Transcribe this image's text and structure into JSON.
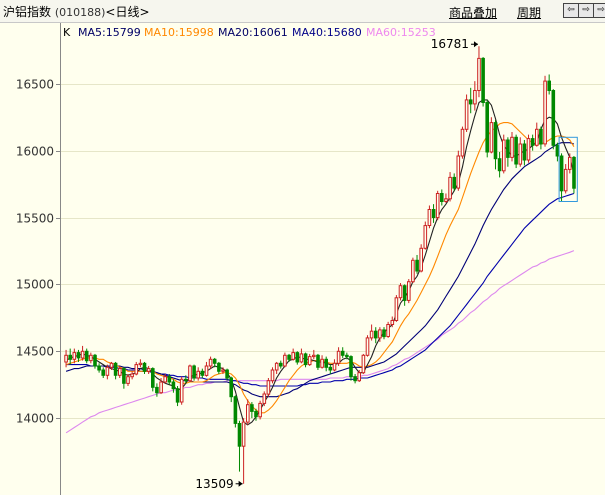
{
  "header": {
    "name": "沪铝指数",
    "code": "(010188)",
    "period": "<日线>",
    "tab_overlay": "商品叠加",
    "tab_cycle": "周期",
    "btn_prev": "⇦",
    "btn_mid": "⇨",
    "btn_next": "⇨"
  },
  "chart_data": {
    "type": "candlestick",
    "ylim": [
      13440,
      16880
    ],
    "yticks": [
      14000,
      14500,
      15000,
      15500,
      16000,
      16500
    ],
    "grid": true,
    "legend": {
      "prefix": "K",
      "items": [
        {
          "label": "MA5:15799",
          "color": "#000066"
        },
        {
          "label": "MA10:15998",
          "color": "#FF8800"
        },
        {
          "label": "MA20:16061",
          "color": "#000066"
        },
        {
          "label": "MA40:15680",
          "color": "#000088"
        },
        {
          "label": "MA60:15253",
          "color": "#EE88EE"
        }
      ]
    },
    "annotations": {
      "high": "16781",
      "low": "13509"
    },
    "colors": {
      "up": "#CC2222",
      "down": "#008800",
      "ma5": "#222222",
      "ma10": "#FF8800",
      "ma20": "#000077",
      "ma40": "#0000AA",
      "ma60": "#DD88EE"
    },
    "candles": [
      [
        14420,
        14470,
        14510,
        14380
      ],
      [
        14470,
        14440,
        14520,
        14400
      ],
      [
        14440,
        14490,
        14520,
        14410
      ],
      [
        14490,
        14450,
        14510,
        14420
      ],
      [
        14450,
        14500,
        14540,
        14430
      ],
      [
        14500,
        14430,
        14520,
        14410
      ],
      [
        14430,
        14470,
        14490,
        14410
      ],
      [
        14470,
        14390,
        14480,
        14370
      ],
      [
        14390,
        14360,
        14410,
        14340
      ],
      [
        14360,
        14320,
        14380,
        14300
      ],
      [
        14320,
        14380,
        14400,
        14290
      ],
      [
        14380,
        14410,
        14420,
        14360
      ],
      [
        14410,
        14320,
        14420,
        14290
      ],
      [
        14320,
        14370,
        14390,
        14300
      ],
      [
        14370,
        14260,
        14380,
        14220
      ],
      [
        14260,
        14310,
        14330,
        14240
      ],
      [
        14310,
        14330,
        14350,
        14290
      ],
      [
        14330,
        14400,
        14420,
        14320
      ],
      [
        14400,
        14410,
        14440,
        14380
      ],
      [
        14410,
        14350,
        14420,
        14330
      ],
      [
        14350,
        14370,
        14390,
        14330
      ],
      [
        14370,
        14230,
        14380,
        14200
      ],
      [
        14230,
        14190,
        14260,
        14160
      ],
      [
        14190,
        14270,
        14300,
        14180
      ],
      [
        14270,
        14310,
        14330,
        14260
      ],
      [
        14310,
        14270,
        14330,
        14250
      ],
      [
        14270,
        14220,
        14290,
        14190
      ],
      [
        14220,
        14120,
        14240,
        14090
      ],
      [
        14120,
        14290,
        14310,
        14100
      ],
      [
        14290,
        14280,
        14320,
        14260
      ],
      [
        14280,
        14390,
        14400,
        14270
      ],
      [
        14390,
        14300,
        14400,
        14280
      ],
      [
        14300,
        14350,
        14380,
        14280
      ],
      [
        14350,
        14320,
        14370,
        14300
      ],
      [
        14320,
        14390,
        14420,
        14310
      ],
      [
        14390,
        14440,
        14460,
        14370
      ],
      [
        14440,
        14410,
        14450,
        14380
      ],
      [
        14410,
        14350,
        14420,
        14330
      ],
      [
        14350,
        14360,
        14380,
        14330
      ],
      [
        14360,
        14300,
        14370,
        14280
      ],
      [
        14300,
        14160,
        14310,
        14120
      ],
      [
        14160,
        13960,
        14170,
        13930
      ],
      [
        13960,
        13790,
        13980,
        13600
      ],
      [
        13790,
        13970,
        14000,
        13509
      ],
      [
        13970,
        14100,
        14140,
        13950
      ],
      [
        14100,
        14050,
        14120,
        14000
      ],
      [
        14050,
        14010,
        14070,
        13980
      ],
      [
        14010,
        14110,
        14130,
        13990
      ],
      [
        14110,
        14180,
        14200,
        14090
      ],
      [
        14180,
        14280,
        14300,
        14160
      ],
      [
        14280,
        14360,
        14380,
        14260
      ],
      [
        14360,
        14410,
        14420,
        14330
      ],
      [
        14410,
        14390,
        14430,
        14370
      ],
      [
        14390,
        14470,
        14490,
        14380
      ],
      [
        14470,
        14440,
        14480,
        14420
      ],
      [
        14440,
        14490,
        14520,
        14430
      ],
      [
        14490,
        14420,
        14500,
        14400
      ],
      [
        14420,
        14480,
        14520,
        14410
      ],
      [
        14480,
        14400,
        14490,
        14380
      ],
      [
        14400,
        14460,
        14480,
        14390
      ],
      [
        14460,
        14470,
        14510,
        14440
      ],
      [
        14470,
        14380,
        14480,
        14360
      ],
      [
        14380,
        14440,
        14470,
        14370
      ],
      [
        14440,
        14380,
        14460,
        14350
      ],
      [
        14380,
        14360,
        14400,
        14330
      ],
      [
        14360,
        14410,
        14440,
        14350
      ],
      [
        14410,
        14500,
        14530,
        14390
      ],
      [
        14500,
        14470,
        14530,
        14450
      ],
      [
        14470,
        14460,
        14490,
        14440
      ],
      [
        14460,
        14310,
        14470,
        14280
      ],
      [
        14310,
        14280,
        14330,
        14260
      ],
      [
        14280,
        14340,
        14360,
        14270
      ],
      [
        14340,
        14470,
        14480,
        14330
      ],
      [
        14470,
        14600,
        14620,
        14460
      ],
      [
        14600,
        14650,
        14700,
        14580
      ],
      [
        14650,
        14600,
        14680,
        14560
      ],
      [
        14600,
        14660,
        14680,
        14570
      ],
      [
        14660,
        14610,
        14680,
        14590
      ],
      [
        14610,
        14700,
        14720,
        14600
      ],
      [
        14700,
        14730,
        14760,
        14680
      ],
      [
        14730,
        14900,
        14920,
        14720
      ],
      [
        14900,
        14990,
        15010,
        14880
      ],
      [
        14990,
        14880,
        15000,
        14840
      ],
      [
        14880,
        15020,
        15040,
        14860
      ],
      [
        15020,
        15180,
        15200,
        15010
      ],
      [
        15180,
        15100,
        15220,
        15080
      ],
      [
        15100,
        15270,
        15300,
        15090
      ],
      [
        15270,
        15440,
        15470,
        15260
      ],
      [
        15440,
        15560,
        15590,
        15420
      ],
      [
        15560,
        15500,
        15600,
        15460
      ],
      [
        15500,
        15680,
        15700,
        15480
      ],
      [
        15680,
        15620,
        15710,
        15590
      ],
      [
        15620,
        15640,
        15680,
        15610
      ],
      [
        15640,
        15800,
        15840,
        15620
      ],
      [
        15800,
        15720,
        15830,
        15700
      ],
      [
        15720,
        15960,
        16000,
        15700
      ],
      [
        15960,
        16160,
        16180,
        15940
      ],
      [
        16160,
        16380,
        16420,
        16140
      ],
      [
        16380,
        16350,
        16470,
        16280
      ],
      [
        16350,
        16450,
        16520,
        16300
      ],
      [
        16450,
        16690,
        16781,
        16400
      ],
      [
        16690,
        16360,
        16700,
        16330
      ],
      [
        16360,
        15990,
        16380,
        15950
      ],
      [
        15990,
        16210,
        16250,
        15980
      ],
      [
        16210,
        15940,
        16230,
        15860
      ],
      [
        15940,
        15850,
        15990,
        15800
      ],
      [
        15850,
        16080,
        16120,
        15830
      ],
      [
        16080,
        15950,
        16100,
        15880
      ],
      [
        15950,
        16100,
        16140,
        15920
      ],
      [
        16100,
        15900,
        16120,
        15870
      ],
      [
        15900,
        16050,
        16100,
        15880
      ],
      [
        16050,
        15930,
        16080,
        15890
      ],
      [
        15930,
        16090,
        16120,
        15910
      ],
      [
        16090,
        16040,
        16120,
        16000
      ],
      [
        16040,
        16160,
        16210,
        16030
      ],
      [
        16160,
        16050,
        16180,
        16010
      ],
      [
        16050,
        16520,
        16560,
        16030
      ],
      [
        16520,
        16450,
        16570,
        16420
      ],
      [
        16450,
        16040,
        16460,
        16010
      ],
      [
        16040,
        15960,
        16060,
        15920
      ],
      [
        15960,
        15700,
        15980,
        15620
      ],
      [
        15700,
        15860,
        15900,
        15680
      ],
      [
        15860,
        15950,
        15980,
        15830
      ],
      [
        15950,
        15720,
        15960,
        15680
      ]
    ],
    "ma5": [
      14430,
      14450,
      14460,
      14470,
      14480,
      14470,
      14460,
      14440,
      14420,
      14400,
      14380,
      14370,
      14360,
      14350,
      14330,
      14320,
      14330,
      14340,
      14370,
      14380,
      14370,
      14330,
      14300,
      14280,
      14260,
      14250,
      14240,
      14210,
      14220,
      14260,
      14310,
      14320,
      14330,
      14340,
      14350,
      14370,
      14390,
      14380,
      14370,
      14340,
      14290,
      14200,
      14080,
      13970,
      13950,
      13970,
      14010,
      14060,
      14120,
      14170,
      14230,
      14300,
      14350,
      14390,
      14430,
      14440,
      14460,
      14450,
      14440,
      14440,
      14430,
      14420,
      14420,
      14410,
      14400,
      14400,
      14410,
      14440,
      14450,
      14430,
      14380,
      14340,
      14340,
      14400,
      14460,
      14540,
      14600,
      14640,
      14670,
      14700,
      14780,
      14860,
      14900,
      14950,
      15020,
      15060,
      15130,
      15220,
      15320,
      15420,
      15500,
      15560,
      15600,
      15650,
      15700,
      15760,
      15880,
      16030,
      16150,
      16260,
      16360,
      16380,
      16380,
      16340,
      16240,
      16120,
      16040,
      16000,
      15960,
      15960,
      15980,
      16000,
      16010,
      16040,
      16060,
      16160,
      16230,
      16250,
      16240,
      16200,
      16100,
      16020,
      15950,
      15830
    ],
    "ma10": [
      14400,
      14410,
      14420,
      14430,
      14440,
      14450,
      14450,
      14450,
      14440,
      14440,
      14420,
      14410,
      14400,
      14380,
      14370,
      14350,
      14350,
      14350,
      14350,
      14350,
      14350,
      14350,
      14330,
      14320,
      14310,
      14300,
      14290,
      14270,
      14260,
      14260,
      14270,
      14270,
      14270,
      14270,
      14280,
      14300,
      14320,
      14330,
      14340,
      14340,
      14330,
      14300,
      14250,
      14180,
      14130,
      14090,
      14060,
      14040,
      14040,
      14060,
      14090,
      14130,
      14180,
      14230,
      14280,
      14320,
      14360,
      14390,
      14410,
      14420,
      14430,
      14430,
      14430,
      14420,
      14410,
      14410,
      14410,
      14410,
      14410,
      14420,
      14410,
      14390,
      14380,
      14390,
      14400,
      14420,
      14450,
      14490,
      14530,
      14570,
      14630,
      14690,
      14740,
      14780,
      14830,
      14880,
      14940,
      15000,
      15060,
      15130,
      15210,
      15290,
      15370,
      15440,
      15500,
      15560,
      15650,
      15740,
      15830,
      15910,
      15990,
      16060,
      16110,
      16150,
      16170,
      16200,
      16210,
      16210,
      16200,
      16170,
      16140,
      16110,
      16080,
      16060,
      16050,
      16050,
      16060,
      16080,
      16100,
      16110,
      16110,
      16100,
      16080,
      16030
    ],
    "ma20": [
      14350,
      14360,
      14370,
      14370,
      14380,
      14390,
      14390,
      14390,
      14390,
      14390,
      14390,
      14390,
      14390,
      14390,
      14380,
      14380,
      14370,
      14370,
      14370,
      14360,
      14360,
      14350,
      14340,
      14330,
      14320,
      14310,
      14300,
      14290,
      14280,
      14280,
      14280,
      14270,
      14270,
      14270,
      14270,
      14270,
      14270,
      14270,
      14270,
      14270,
      14260,
      14250,
      14230,
      14210,
      14200,
      14180,
      14170,
      14160,
      14160,
      14160,
      14160,
      14160,
      14170,
      14180,
      14190,
      14210,
      14220,
      14240,
      14260,
      14280,
      14290,
      14300,
      14310,
      14320,
      14330,
      14340,
      14350,
      14360,
      14370,
      14380,
      14380,
      14380,
      14380,
      14380,
      14390,
      14400,
      14410,
      14420,
      14440,
      14460,
      14480,
      14510,
      14540,
      14570,
      14600,
      14630,
      14660,
      14690,
      14730,
      14770,
      14810,
      14860,
      14910,
      14960,
      15010,
      15060,
      15120,
      15180,
      15240,
      15300,
      15370,
      15440,
      15500,
      15560,
      15610,
      15660,
      15710,
      15750,
      15790,
      15820,
      15850,
      15880,
      15900,
      15920,
      15940,
      15960,
      15990,
      16010,
      16030,
      16050,
      16060,
      16060,
      16060,
      16050
    ],
    "ma40": [
      14400,
      14400,
      14400,
      14400,
      14400,
      14400,
      14390,
      14390,
      14390,
      14390,
      14380,
      14380,
      14380,
      14370,
      14370,
      14360,
      14360,
      14360,
      14350,
      14350,
      14350,
      14340,
      14340,
      14330,
      14330,
      14320,
      14320,
      14310,
      14310,
      14310,
      14300,
      14300,
      14300,
      14300,
      14290,
      14290,
      14290,
      14290,
      14290,
      14290,
      14280,
      14280,
      14270,
      14260,
      14260,
      14250,
      14250,
      14240,
      14240,
      14240,
      14240,
      14240,
      14240,
      14240,
      14240,
      14240,
      14240,
      14250,
      14250,
      14260,
      14260,
      14260,
      14270,
      14270,
      14270,
      14280,
      14280,
      14280,
      14290,
      14290,
      14290,
      14300,
      14300,
      14300,
      14310,
      14320,
      14330,
      14340,
      14350,
      14360,
      14380,
      14390,
      14410,
      14430,
      14450,
      14470,
      14490,
      14510,
      14540,
      14570,
      14600,
      14630,
      14660,
      14690,
      14730,
      14770,
      14810,
      14850,
      14890,
      14930,
      14970,
      15010,
      15060,
      15100,
      15140,
      15180,
      15220,
      15260,
      15300,
      15340,
      15380,
      15420,
      15450,
      15480,
      15510,
      15540,
      15570,
      15600,
      15620,
      15640,
      15650,
      15660,
      15670,
      15680
    ],
    "ma60": [
      13890,
      13910,
      13930,
      13950,
      13970,
      13990,
      14010,
      14020,
      14040,
      14050,
      14060,
      14070,
      14080,
      14090,
      14100,
      14110,
      14120,
      14130,
      14140,
      14150,
      14160,
      14170,
      14180,
      14190,
      14190,
      14200,
      14210,
      14210,
      14220,
      14230,
      14230,
      14240,
      14250,
      14250,
      14260,
      14260,
      14270,
      14270,
      14270,
      14280,
      14280,
      14280,
      14280,
      14280,
      14280,
      14280,
      14280,
      14280,
      14280,
      14280,
      14280,
      14280,
      14290,
      14290,
      14290,
      14290,
      14290,
      14290,
      14290,
      14290,
      14290,
      14290,
      14290,
      14290,
      14300,
      14300,
      14300,
      14300,
      14310,
      14310,
      14310,
      14310,
      14320,
      14320,
      14330,
      14340,
      14350,
      14360,
      14370,
      14390,
      14400,
      14420,
      14440,
      14450,
      14470,
      14490,
      14510,
      14530,
      14550,
      14570,
      14590,
      14620,
      14640,
      14660,
      14680,
      14710,
      14730,
      14760,
      14790,
      14810,
      14840,
      14870,
      14890,
      14920,
      14940,
      14970,
      14990,
      15010,
      15030,
      15050,
      15070,
      15090,
      15110,
      15130,
      15140,
      15160,
      15170,
      15190,
      15200,
      15210,
      15220,
      15230,
      15240,
      15253
    ]
  }
}
